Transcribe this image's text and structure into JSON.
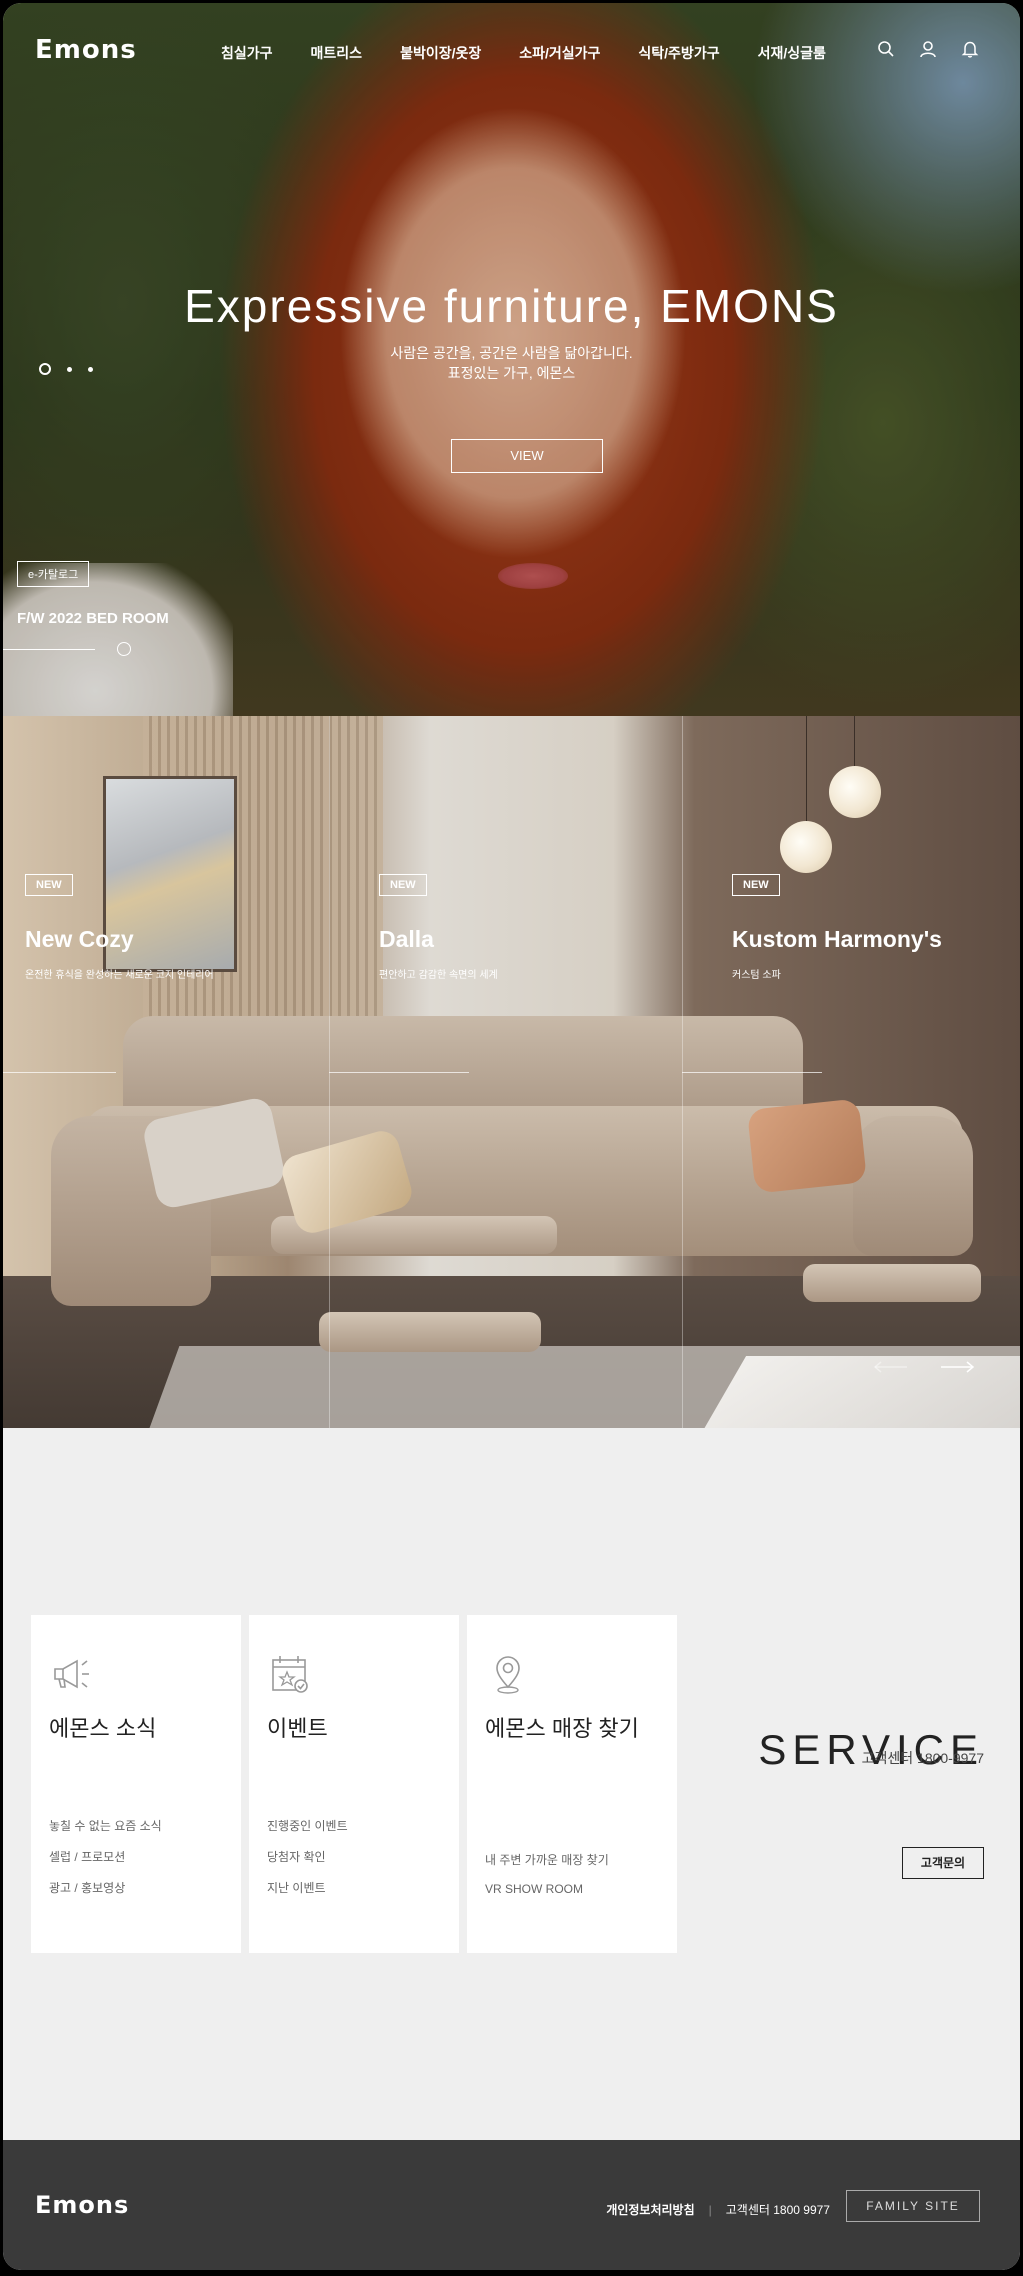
{
  "brand": {
    "logo": "Emons"
  },
  "nav": {
    "menu": [
      "침실가구",
      "매트리스",
      "붙박이장/옷장",
      "소파/거실가구",
      "식탁/주방가구",
      "서재/싱글룸"
    ],
    "icons": [
      "search-icon",
      "user-icon",
      "bell-icon"
    ]
  },
  "hero": {
    "title": "Expressive furniture, EMONS",
    "subtitle_line1": "사람은 공간을, 공간은 사람을 닮아갑니다.",
    "subtitle_line2": "표정있는 가구, 에몬스",
    "view_label": "VIEW",
    "ecatalog_label": "e-카탈로그",
    "collection": "F/W 2022 BED ROOM"
  },
  "products": [
    {
      "badge": "NEW",
      "name": "New Cozy",
      "desc": "온전한 휴식을 완성하는 새로운 코지 인테리어"
    },
    {
      "badge": "NEW",
      "name": "Dalla",
      "desc": "편안하고 감감한 속면의 세계"
    },
    {
      "badge": "NEW",
      "name": "Kustom Harmony's",
      "desc": "커스텀 소파"
    }
  ],
  "service": {
    "cards": [
      {
        "title": "에몬스 소식",
        "icon": "megaphone-icon",
        "links": [
          "놓칠 수 없는 요즘 소식",
          "셀럽 / 프로모션",
          "광고 / 홍보영상"
        ]
      },
      {
        "title": "이벤트",
        "icon": "calendar-icon",
        "links": [
          "진행중인 이벤트",
          "당첨자 확인",
          "지난 이벤트"
        ]
      },
      {
        "title": "에몬스 매장 찾기",
        "icon": "location-pin-icon",
        "links": [
          "내 주변 가까운 매장 찾기",
          "VR SHOW ROOM"
        ]
      }
    ],
    "title": "SERVICE",
    "phone": "고객센터 1800-9977",
    "inquiry_label": "고객문의"
  },
  "footer": {
    "logo": "Emons",
    "privacy": "개인정보처리방침",
    "separator": "|",
    "phone": "고객센터 1800 9977",
    "family_site": "FAMILY SITE"
  }
}
